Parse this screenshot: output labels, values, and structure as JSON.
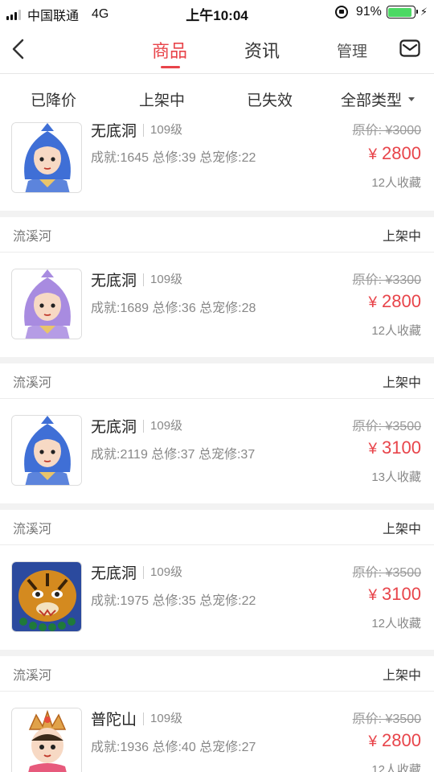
{
  "status_bar": {
    "carrier": "中国联通",
    "network": "4G",
    "time": "上午10:04",
    "battery": "91%",
    "battery_level": 0.91
  },
  "nav": {
    "tabs": [
      {
        "label": "商品",
        "active": true
      },
      {
        "label": "资讯",
        "active": false
      },
      {
        "label": "管理",
        "active": false
      }
    ]
  },
  "filters": [
    {
      "label": "已降价"
    },
    {
      "label": "上架中"
    },
    {
      "label": "已失效"
    },
    {
      "label": "全部类型"
    }
  ],
  "items": [
    {
      "seller": "",
      "status": "",
      "name": "无底洞",
      "level": "109级",
      "stats": "成就:1645 总修:39 总宠修:22",
      "original_price": "原价: ¥3000",
      "currency": "¥",
      "price": "2800",
      "favorites": "12人收藏",
      "avatar_icon": "blue-hair-character-icon",
      "avatar_color": "#3f6fd6"
    },
    {
      "seller": "流溪河",
      "status": "上架中",
      "name": "无底洞",
      "level": "109级",
      "stats": "成就:1689 总修:36 总宠修:28",
      "original_price": "原价: ¥3300",
      "currency": "¥",
      "price": "2800",
      "favorites": "12人收藏",
      "avatar_icon": "purple-hair-character-icon",
      "avatar_color": "#a88be0"
    },
    {
      "seller": "流溪河",
      "status": "上架中",
      "name": "无底洞",
      "level": "109级",
      "stats": "成就:2119 总修:37 总宠修:37",
      "original_price": "原价: ¥3500",
      "currency": "¥",
      "price": "3100",
      "favorites": "13人收藏",
      "avatar_icon": "blue-hair-character-icon",
      "avatar_color": "#3f6fd6"
    },
    {
      "seller": "流溪河",
      "status": "上架中",
      "name": "无底洞",
      "level": "109级",
      "stats": "成就:1975 总修:35 总宠修:22",
      "original_price": "原价: ¥3500",
      "currency": "¥",
      "price": "3100",
      "favorites": "12人收藏",
      "avatar_icon": "tiger-character-icon",
      "avatar_color": "#d48a1f"
    },
    {
      "seller": "流溪河",
      "status": "上架中",
      "name": "普陀山",
      "level": "109级",
      "stats": "成就:1936 总修:40 总宠修:27",
      "original_price": "原价: ¥3500",
      "currency": "¥",
      "price": "2800",
      "favorites": "12人收藏",
      "avatar_icon": "crowned-girl-character-icon",
      "avatar_color": "#e0a24a"
    }
  ]
}
